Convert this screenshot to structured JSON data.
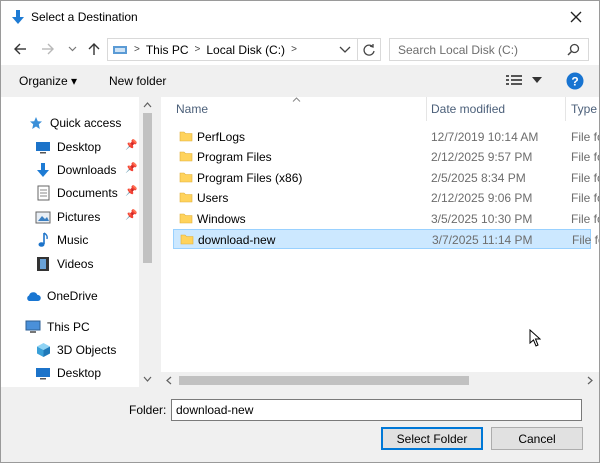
{
  "window": {
    "title": "Select a Destination"
  },
  "address": {
    "crumbs": [
      "This PC",
      "Local Disk (C:)"
    ]
  },
  "search": {
    "placeholder": "Search Local Disk (C:)"
  },
  "toolbar": {
    "organize_label": "Organize ▾",
    "new_folder_label": "New folder"
  },
  "nav": {
    "items": [
      {
        "label": "Quick access",
        "icon": "star-icon"
      },
      {
        "label": "Desktop",
        "icon": "desktop-icon",
        "pinned": true
      },
      {
        "label": "Downloads",
        "icon": "download-icon",
        "pinned": true
      },
      {
        "label": "Documents",
        "icon": "documents-icon",
        "pinned": true
      },
      {
        "label": "Pictures",
        "icon": "pictures-icon",
        "pinned": true
      },
      {
        "label": "Music",
        "icon": "music-icon"
      },
      {
        "label": "Videos",
        "icon": "videos-icon"
      },
      {
        "label": "OneDrive",
        "icon": "cloud-icon"
      },
      {
        "label": "This PC",
        "icon": "computer-icon"
      },
      {
        "label": "3D Objects",
        "icon": "cube-icon"
      },
      {
        "label": "Desktop",
        "icon": "desktop-icon"
      }
    ]
  },
  "list": {
    "columns": {
      "name": "Name",
      "date": "Date modified",
      "type": "Type"
    },
    "rows": [
      {
        "name": "PerfLogs",
        "date": "12/7/2019 10:14 AM",
        "type": "File fo"
      },
      {
        "name": "Program Files",
        "date": "2/12/2025 9:57 PM",
        "type": "File fo"
      },
      {
        "name": "Program Files (x86)",
        "date": "2/5/2025 8:34 PM",
        "type": "File fo"
      },
      {
        "name": "Users",
        "date": "2/12/2025 9:06 PM",
        "type": "File fo"
      },
      {
        "name": "Windows",
        "date": "3/5/2025 10:30 PM",
        "type": "File fo"
      },
      {
        "name": "download-new",
        "date": "3/7/2025 11:14 PM",
        "type": "File fo",
        "selected": true
      }
    ]
  },
  "footer": {
    "folder_label": "Folder:",
    "folder_value": "download-new",
    "select_label": "Select Folder",
    "cancel_label": "Cancel"
  },
  "colors": {
    "accent": "#0078d7",
    "folder": "#ffd35c",
    "selection": "#cce8ff"
  }
}
